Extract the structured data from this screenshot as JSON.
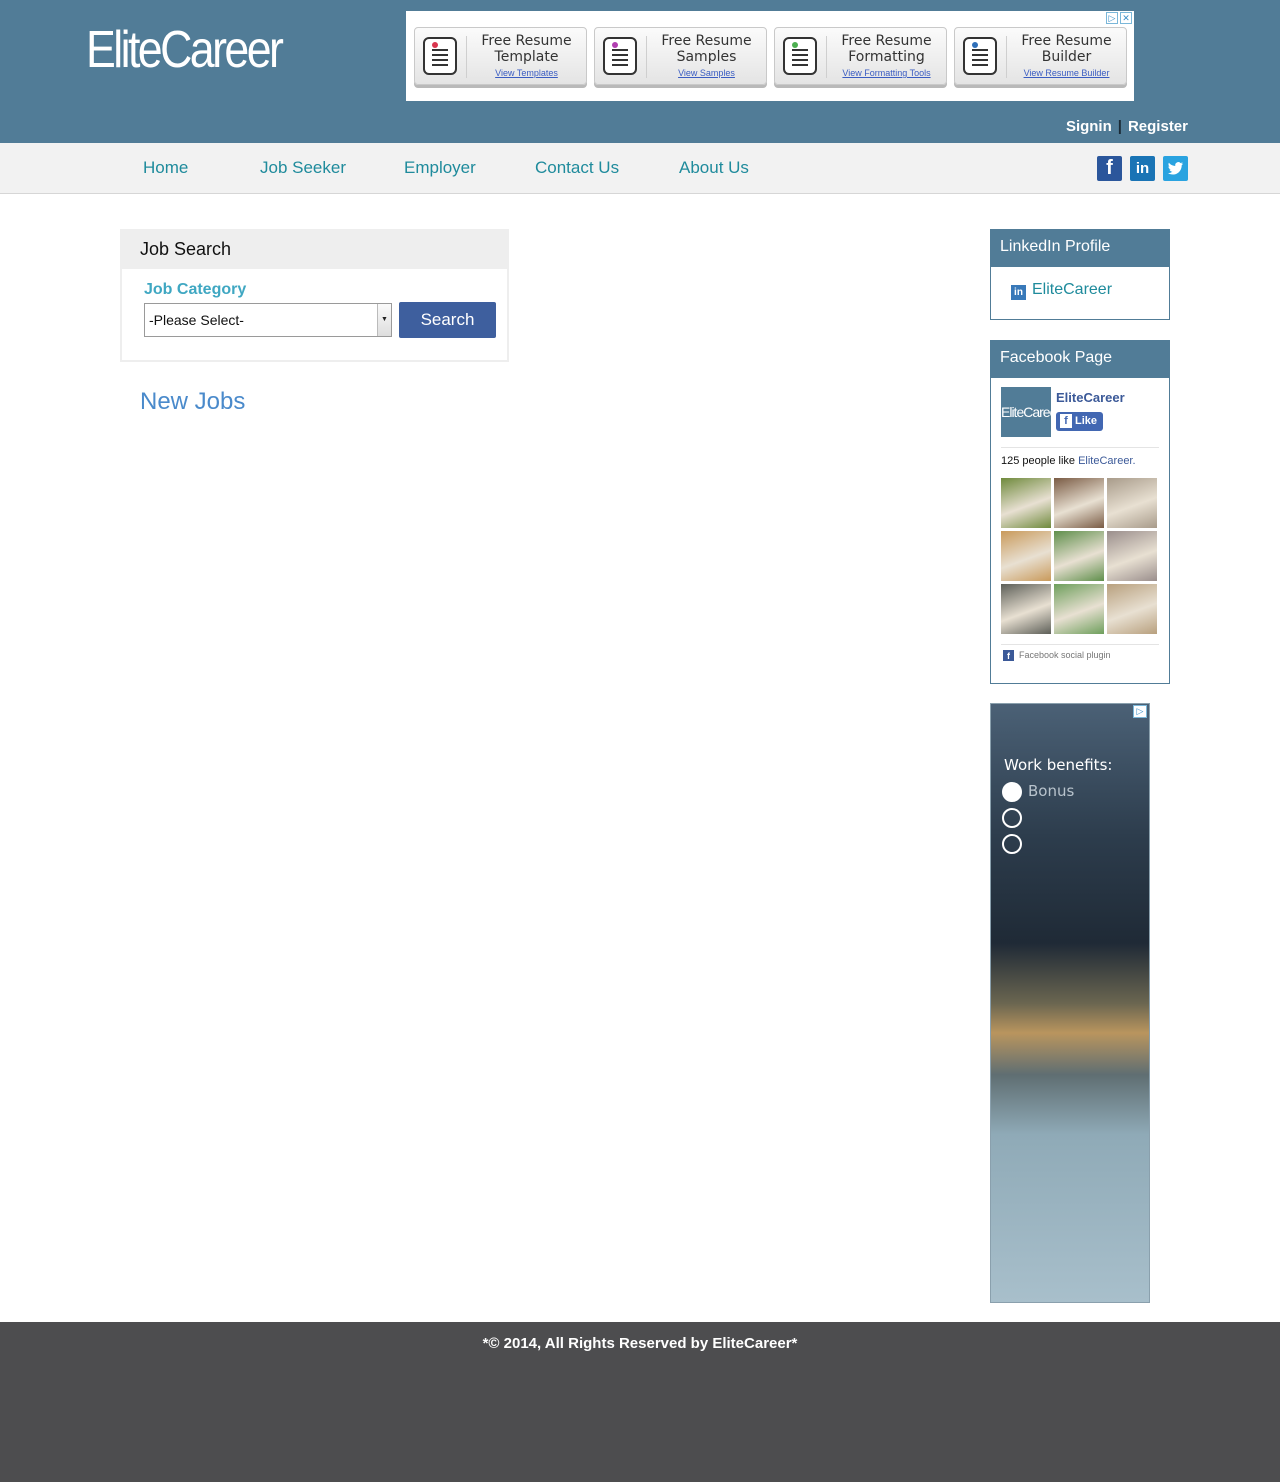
{
  "header": {
    "logo": "EliteCareer",
    "signin": "Signin",
    "separator": "|",
    "register": "Register"
  },
  "top_ad": {
    "items": [
      {
        "title": "Free Resume Template",
        "link": "View Templates",
        "pin_color": "#d9364f"
      },
      {
        "title": "Free Resume Samples",
        "link": "View Samples",
        "pin_color": "#b13fb0"
      },
      {
        "title": "Free Resume Formatting",
        "link": "View Formatting Tools",
        "pin_color": "#4caf50"
      },
      {
        "title": "Free Resume Builder",
        "link": "View Resume Builder",
        "pin_color": "#2f6fb8"
      }
    ]
  },
  "nav": {
    "items": [
      "Home",
      "Job Seeker",
      "Employer",
      "Contact Us",
      "About Us"
    ],
    "social": {
      "facebook": "f",
      "linkedin": "in",
      "twitter": "t"
    }
  },
  "job_search": {
    "title": "Job Search",
    "category_label": "Job Category",
    "select_value": "-Please Select-",
    "search_button": "Search"
  },
  "new_jobs": "New Jobs",
  "linkedin_widget": {
    "title": "LinkedIn Profile",
    "link": "EliteCareer"
  },
  "facebook_widget": {
    "title": "Facebook Page",
    "page_logo": "EliteCareer",
    "page_name": "EliteCareer",
    "like_button": "Like",
    "likes_count_text": "125 people like",
    "likes_page_link": "EliteCareer.",
    "plugin_label": "Facebook social plugin",
    "face_colors": [
      "#6f8a3c",
      "#7a5b44",
      "#a89b8a",
      "#c99a5b",
      "#5f8f4b",
      "#9a8e8c",
      "#5d5f58",
      "#6e9f5c",
      "#b8a07e"
    ]
  },
  "side_ad": {
    "marker": "▷",
    "heading": "Work benefits:",
    "option_1": "Bonus"
  },
  "footer": {
    "text": "*© 2014, All Rights Reserved by EliteCareer*"
  },
  "colors": {
    "header_bg": "#517c97",
    "nav_link": "#1f8b9c",
    "accent_button": "#3e5f9e",
    "footer_bg": "#4d4d4f"
  }
}
